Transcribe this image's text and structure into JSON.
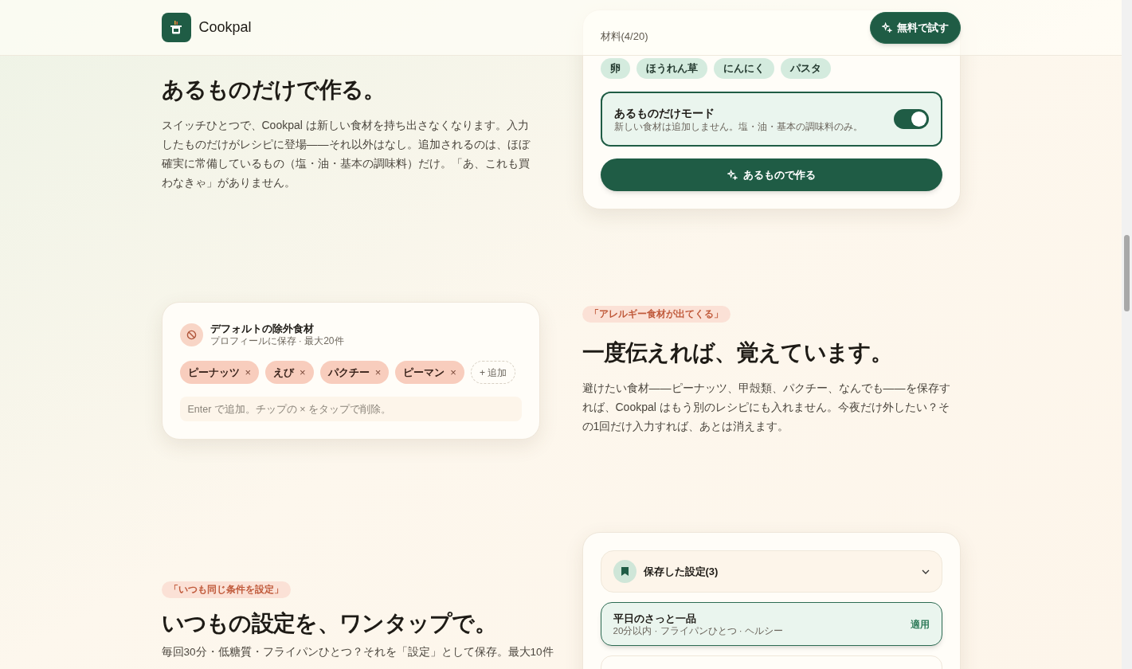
{
  "header": {
    "brand": "Cookpal",
    "cta": "無料で試す"
  },
  "sections": [
    {
      "kind": "pantry",
      "title": "あるものだけで作る。",
      "body": "スイッチひとつで、Cookpal は新しい食材を持ち出さなくなります。入力したものだけがレシピに登場——それ以外はなし。追加されるのは、ほぼ確実に常備しているもの（塩・油・基本の調味料）だけ。「あ、これも買わなきゃ」がありません。",
      "card": {
        "label": "材料(4/20)",
        "chips": [
          "卵",
          "ほうれん草",
          "にんにく",
          "パスタ"
        ],
        "mode": {
          "title": "あるものだけモード",
          "subtitle": "新しい食材は追加しません。塩・油・基本の調味料のみ。",
          "on": true
        },
        "button": "あるもので作る"
      }
    },
    {
      "kind": "exclusions",
      "badge": "「アレルギー食材が出てくる」",
      "title": "一度伝えれば、覚えています。",
      "body": "避けたい食材——ピーナッツ、甲殻類、パクチー、なんでも——を保存すれば、Cookpal はもう別のレシピにも入れません。今夜だけ外したい？その1回だけ入力すれば、あとは消えます。",
      "card": {
        "title": "デフォルトの除外食材",
        "subtitle": "プロフィールに保存 · 最大20件",
        "chips": [
          {
            "label": "ピーナッツ",
            "remove": "×"
          },
          {
            "label": "えび",
            "remove": "×"
          },
          {
            "label": "パクチー",
            "remove": "×"
          },
          {
            "label": "ピーマン",
            "remove": "×"
          }
        ],
        "add": "+ 追加",
        "placeholder": "Enter で追加。チップの × をタップで削除。"
      }
    },
    {
      "kind": "presets",
      "badge": "「いつも同じ条件を設定」",
      "title": "いつもの設定を、ワンタップで。",
      "body": "毎回30分・低糖質・フライパンひとつ？それを「設定」として保存。最大10件",
      "card": {
        "title": "保存した設定(3)",
        "items": [
          {
            "name": "平日のさっと一品",
            "detail": "20分以内 · フライパンひとつ · ヘルシー",
            "action": "適用",
            "selected": true
          },
          {
            "selected": false
          }
        ]
      }
    }
  ]
}
